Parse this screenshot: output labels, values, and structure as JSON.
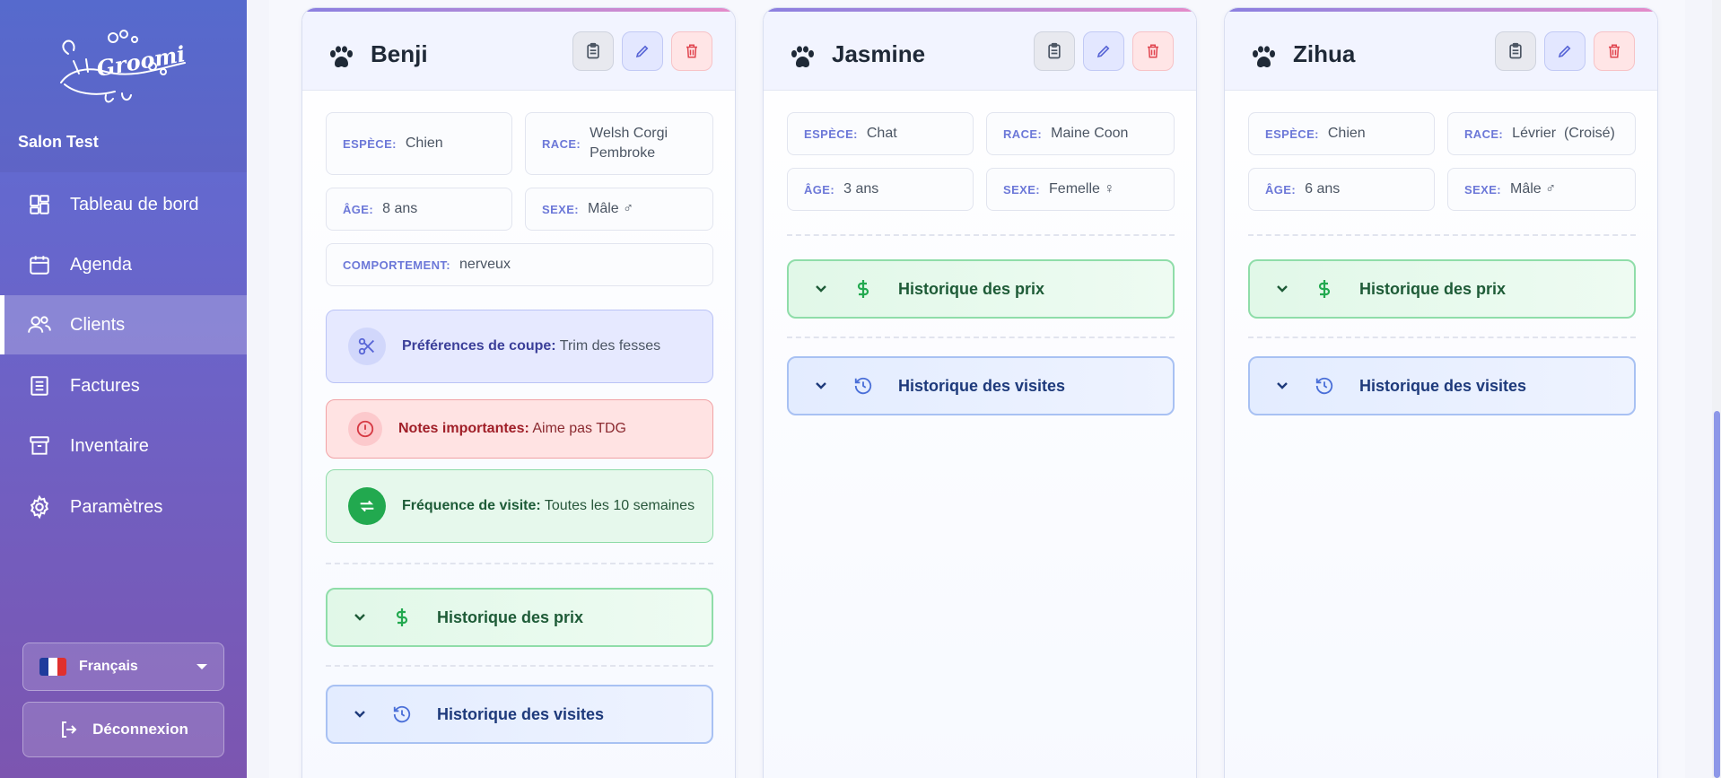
{
  "app": {
    "salon_name": "Salon Test",
    "logo_text": "Groomi"
  },
  "sidebar": {
    "items": [
      {
        "label": "Tableau de bord",
        "icon": "dashboard-icon"
      },
      {
        "label": "Agenda",
        "icon": "calendar-icon"
      },
      {
        "label": "Clients",
        "icon": "users-icon",
        "active": true
      },
      {
        "label": "Factures",
        "icon": "receipt-icon"
      },
      {
        "label": "Inventaire",
        "icon": "archive-icon"
      },
      {
        "label": "Paramètres",
        "icon": "gear-icon"
      }
    ],
    "language": "Français",
    "logout": "Déconnexion"
  },
  "labels": {
    "species": "ESPÈCE:",
    "breed": "RACE:",
    "age": "ÂGE:",
    "sex": "SEXE:",
    "behavior": "COMPORTEMENT:",
    "cut_prefs": "Préférences de coupe:",
    "important_notes": "Notes importantes:",
    "visit_frequency": "Fréquence de visite:",
    "price_history": "Historique des prix",
    "visit_history": "Historique des visites"
  },
  "pets": [
    {
      "name": "Benji",
      "species": "Chien",
      "breed": "Welsh Corgi Pembroke",
      "age": "8 ans",
      "sex": "Mâle ♂",
      "behavior": "nerveux",
      "cut_prefs": "Trim des fesses",
      "important_notes": "Aime pas TDG",
      "visit_frequency": "Toutes les 10 semaines"
    },
    {
      "name": "Jasmine",
      "species": "Chat",
      "breed": "Maine Coon",
      "age": "3 ans",
      "sex": "Femelle ♀"
    },
    {
      "name": "Zihua",
      "species": "Chien",
      "breed": "Lévrier  (Croisé)",
      "age": "6 ans",
      "sex": "Mâle ♂"
    }
  ],
  "colors": {
    "accent": "#6c78d8",
    "sidebar_top": "#5a6fd6",
    "sidebar_bottom": "#7c55b0"
  }
}
